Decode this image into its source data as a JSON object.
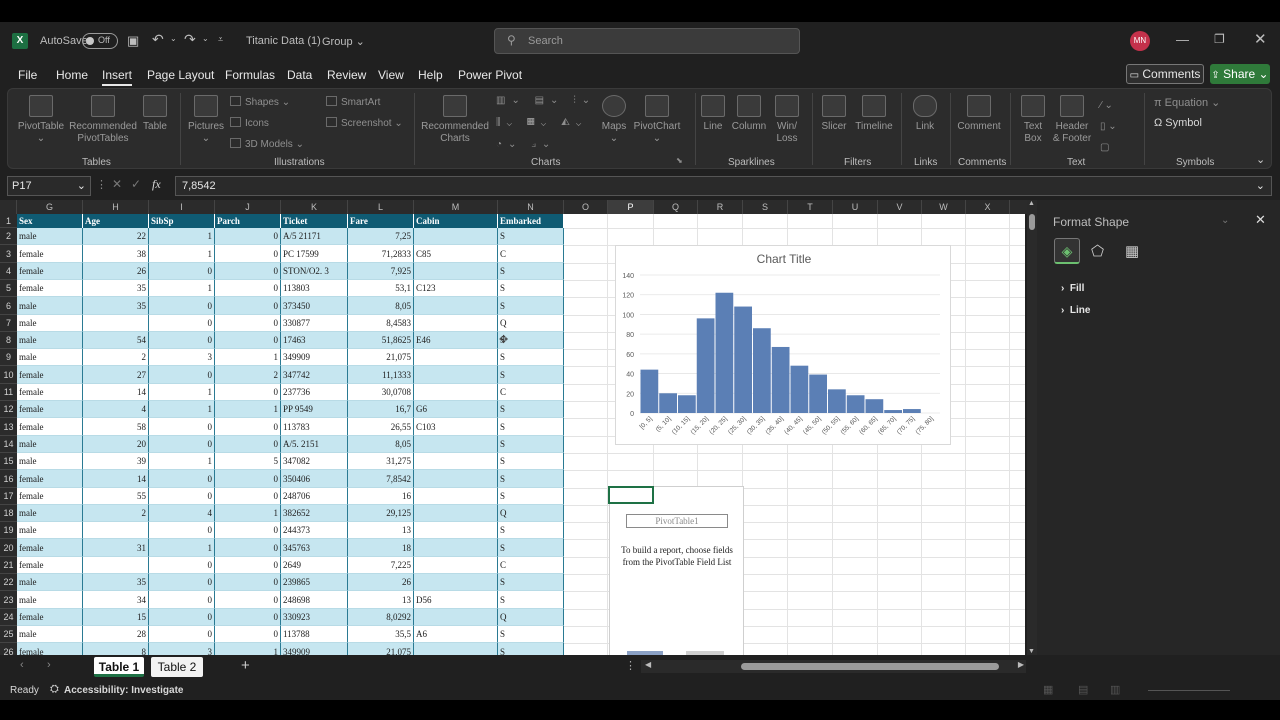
{
  "title_bar": {
    "autosave_label": "AutoSave",
    "autosave_state": "Off",
    "document_title": "Titanic Data (1)",
    "group_label": "Group",
    "search_placeholder": "Search",
    "user_initials": "MN"
  },
  "menu": {
    "items": [
      "File",
      "Home",
      "Insert",
      "Page Layout",
      "Formulas",
      "Data",
      "Review",
      "View",
      "Help",
      "Power Pivot"
    ],
    "active": "Insert",
    "comments_label": "Comments",
    "share_label": "Share"
  },
  "ribbon": {
    "tables": {
      "pivot": "PivotTable",
      "recommended_pivot": "Recommended PivotTables",
      "table": "Table",
      "group": "Tables"
    },
    "illustrations": {
      "pictures": "Pictures",
      "shapes": "Shapes",
      "icons": "Icons",
      "models": "3D Models",
      "smartart": "SmartArt",
      "screenshot": "Screenshot",
      "group": "Illustrations"
    },
    "charts": {
      "recommended": "Recommended Charts",
      "maps": "Maps",
      "pivotchart": "PivotChart",
      "group": "Charts"
    },
    "sparklines": {
      "line": "Line",
      "column": "Column",
      "winloss": "Win/ Loss",
      "group": "Sparklines"
    },
    "filters": {
      "slicer": "Slicer",
      "timeline": "Timeline",
      "group": "Filters"
    },
    "links": {
      "link": "Link",
      "group": "Links"
    },
    "comments": {
      "comment": "Comment",
      "group": "Comments"
    },
    "text": {
      "textbox": "Text Box",
      "header": "Header & Footer",
      "group": "Text"
    },
    "symbols": {
      "equation": "Equation",
      "symbol": "Symbol",
      "group": "Symbols"
    }
  },
  "formula_bar": {
    "name_box": "P17",
    "fx": "fx",
    "value": "7,8542"
  },
  "grid": {
    "columns": [
      "G",
      "H",
      "I",
      "J",
      "K",
      "L",
      "M",
      "N",
      "O",
      "P",
      "Q",
      "R",
      "S",
      "T",
      "U",
      "V",
      "W",
      "X"
    ],
    "headers": [
      "Sex",
      "Age",
      "SibSp",
      "Parch",
      "Ticket",
      "Fare",
      "Cabin",
      "Embarked"
    ],
    "rows": [
      {
        "n": "2",
        "c": [
          "male",
          "22",
          "1",
          "0",
          "A/5 21171",
          "7,25",
          "",
          "S"
        ]
      },
      {
        "n": "3",
        "c": [
          "female",
          "38",
          "1",
          "0",
          "PC 17599",
          "71,2833",
          "C85",
          "C"
        ]
      },
      {
        "n": "4",
        "c": [
          "female",
          "26",
          "0",
          "0",
          "STON/O2. 3",
          "7,925",
          "",
          "S"
        ]
      },
      {
        "n": "5",
        "c": [
          "female",
          "35",
          "1",
          "0",
          "113803",
          "53,1",
          "C123",
          "S"
        ]
      },
      {
        "n": "6",
        "c": [
          "male",
          "35",
          "0",
          "0",
          "373450",
          "8,05",
          "",
          "S"
        ]
      },
      {
        "n": "7",
        "c": [
          "male",
          "",
          "0",
          "0",
          "330877",
          "8,4583",
          "",
          "Q"
        ]
      },
      {
        "n": "8",
        "c": [
          "male",
          "54",
          "0",
          "0",
          "17463",
          "51,8625",
          "E46",
          "S"
        ]
      },
      {
        "n": "9",
        "c": [
          "male",
          "2",
          "3",
          "1",
          "349909",
          "21,075",
          "",
          "S"
        ]
      },
      {
        "n": "10",
        "c": [
          "female",
          "27",
          "0",
          "2",
          "347742",
          "11,1333",
          "",
          "S"
        ]
      },
      {
        "n": "11",
        "c": [
          "female",
          "14",
          "1",
          "0",
          "237736",
          "30,0708",
          "",
          "C"
        ]
      },
      {
        "n": "12",
        "c": [
          "female",
          "4",
          "1",
          "1",
          "PP 9549",
          "16,7",
          "G6",
          "S"
        ]
      },
      {
        "n": "13",
        "c": [
          "female",
          "58",
          "0",
          "0",
          "113783",
          "26,55",
          "C103",
          "S"
        ]
      },
      {
        "n": "14",
        "c": [
          "male",
          "20",
          "0",
          "0",
          "A/5. 2151",
          "8,05",
          "",
          "S"
        ]
      },
      {
        "n": "15",
        "c": [
          "male",
          "39",
          "1",
          "5",
          "347082",
          "31,275",
          "",
          "S"
        ]
      },
      {
        "n": "16",
        "c": [
          "female",
          "14",
          "0",
          "0",
          "350406",
          "7,8542",
          "",
          "S"
        ]
      },
      {
        "n": "17",
        "c": [
          "female",
          "55",
          "0",
          "0",
          "248706",
          "16",
          "",
          "S"
        ]
      },
      {
        "n": "18",
        "c": [
          "male",
          "2",
          "4",
          "1",
          "382652",
          "29,125",
          "",
          "Q"
        ]
      },
      {
        "n": "19",
        "c": [
          "male",
          "",
          "0",
          "0",
          "244373",
          "13",
          "",
          "S"
        ]
      },
      {
        "n": "20",
        "c": [
          "female",
          "31",
          "1",
          "0",
          "345763",
          "18",
          "",
          "S"
        ]
      },
      {
        "n": "21",
        "c": [
          "female",
          "",
          "0",
          "0",
          "2649",
          "7,225",
          "",
          "C"
        ]
      },
      {
        "n": "22",
        "c": [
          "male",
          "35",
          "0",
          "0",
          "239865",
          "26",
          "",
          "S"
        ]
      },
      {
        "n": "23",
        "c": [
          "male",
          "34",
          "0",
          "0",
          "248698",
          "13",
          "D56",
          "S"
        ]
      },
      {
        "n": "24",
        "c": [
          "female",
          "15",
          "0",
          "0",
          "330923",
          "8,0292",
          "",
          "Q"
        ]
      },
      {
        "n": "25",
        "c": [
          "male",
          "28",
          "0",
          "0",
          "113788",
          "35,5",
          "A6",
          "S"
        ]
      },
      {
        "n": "26",
        "c": [
          "female",
          "8",
          "3",
          "1",
          "349909",
          "21,075",
          "",
          "S"
        ]
      }
    ]
  },
  "chart_data": {
    "type": "bar",
    "title": "Chart Title",
    "categories": [
      "[0, 5]",
      "(5, 10]",
      "(10, 15]",
      "(15, 20]",
      "(20, 25]",
      "(25, 30]",
      "(30, 35]",
      "(35, 40]",
      "(40, 45]",
      "(45, 50]",
      "(50, 55]",
      "(55, 60]",
      "(60, 65]",
      "(65, 70]",
      "(70, 75]",
      "(75, 80]"
    ],
    "values": [
      44,
      20,
      18,
      96,
      122,
      108,
      86,
      67,
      48,
      39,
      24,
      18,
      14,
      3,
      4,
      0
    ],
    "ylim": [
      0,
      140
    ],
    "yticks": [
      0,
      20,
      40,
      60,
      80,
      100,
      120,
      140
    ],
    "grid": true,
    "bar_color": "#5b7fb5"
  },
  "pivot": {
    "name": "PivotTable1",
    "instructions": "To build a report, choose fields from the PivotTable Field List"
  },
  "format_pane": {
    "title": "Format Shape",
    "sections": [
      "Fill",
      "Line"
    ]
  },
  "sheet_tabs": [
    "Table 1",
    "Table 2"
  ],
  "status": {
    "ready": "Ready",
    "accessibility": "Accessibility: Investigate"
  }
}
